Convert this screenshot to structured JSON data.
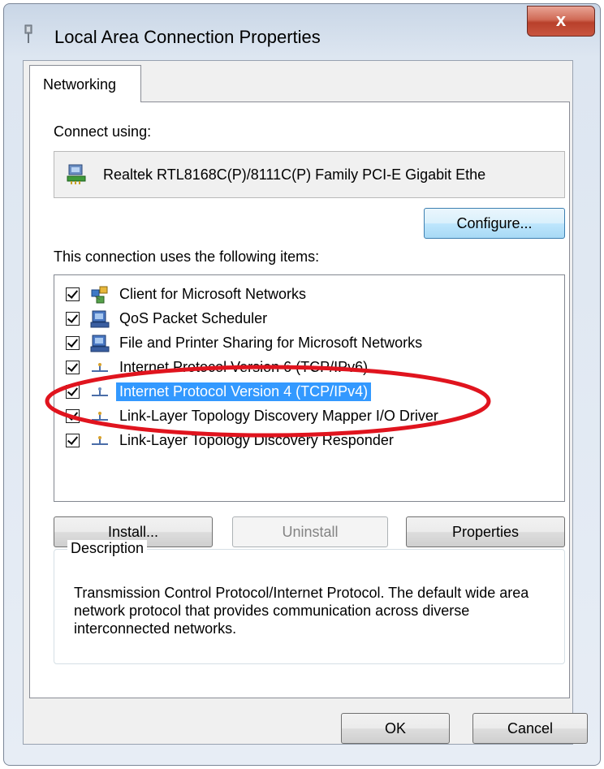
{
  "window": {
    "title": "Local Area Connection Properties",
    "close_label": "x"
  },
  "tab": {
    "label": "Networking"
  },
  "connect_using": {
    "label": "Connect using:",
    "adapter_name": "Realtek RTL8168C(P)/8111C(P) Family PCI-E Gigabit Ethe",
    "configure_label": "Configure..."
  },
  "items_section": {
    "label": "This connection uses the following items:",
    "items": [
      {
        "label": "Client for Microsoft Networks",
        "checked": true,
        "icon": "network-client-icon"
      },
      {
        "label": "QoS Packet Scheduler",
        "checked": true,
        "icon": "service-icon"
      },
      {
        "label": "File and Printer Sharing for Microsoft Networks",
        "checked": true,
        "icon": "service-icon"
      },
      {
        "label": "Internet Protocol Version 6 (TCP/IPv6)",
        "checked": true,
        "icon": "protocol-icon"
      },
      {
        "label": "Internet Protocol Version 4 (TCP/IPv4)",
        "checked": true,
        "icon": "protocol-icon",
        "selected": true
      },
      {
        "label": "Link-Layer Topology Discovery Mapper I/O Driver",
        "checked": true,
        "icon": "protocol-icon"
      },
      {
        "label": "Link-Layer Topology Discovery Responder",
        "checked": true,
        "icon": "protocol-icon"
      }
    ]
  },
  "buttons": {
    "install": "Install...",
    "uninstall": "Uninstall",
    "properties": "Properties",
    "ok": "OK",
    "cancel": "Cancel"
  },
  "description": {
    "title": "Description",
    "text": "Transmission Control Protocol/Internet Protocol. The default wide area network protocol that provides communication across diverse interconnected networks."
  },
  "annotation": {
    "color": "#e0141e"
  }
}
